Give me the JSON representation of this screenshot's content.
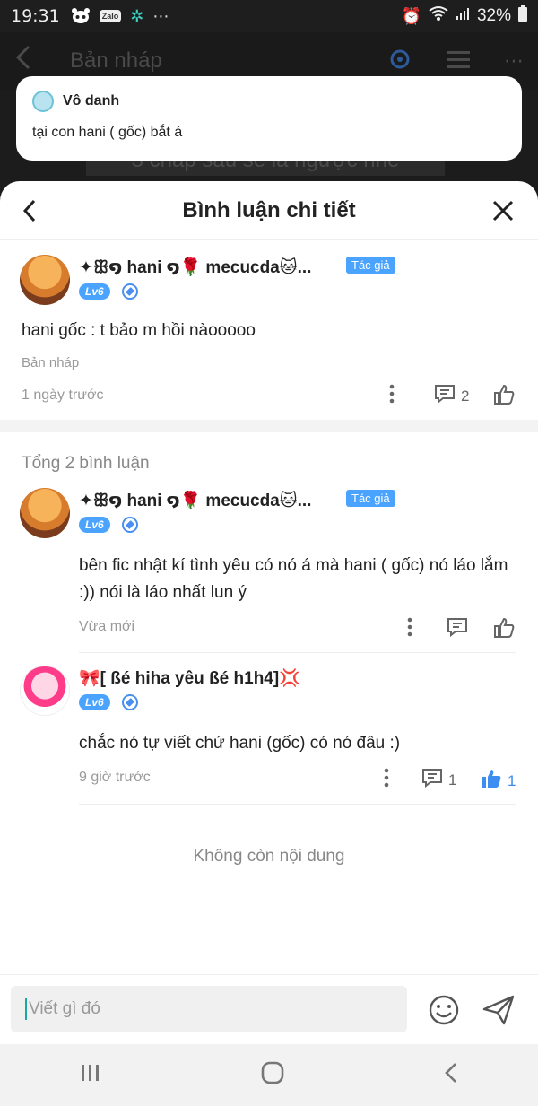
{
  "status": {
    "time": "19:31",
    "battery": "32%",
    "zalo": "Zalo"
  },
  "app": {
    "title": "Bản nháp",
    "bg_text": "3 chap sau sẽ là ngược nhé"
  },
  "notification": {
    "name": "Vô danh",
    "message": "tại con hani ( gốc) bắt á"
  },
  "sheet": {
    "title": "Bình luận chi tiết"
  },
  "main_comment": {
    "username": "✦ꕥ໑ hani ໑🌹 mecucda🐱...",
    "author_badge": "Tác giả",
    "level": "Lv6",
    "text": "hani gốc : t bảo m hồi nàooooo",
    "source": "Bản nháp",
    "time": "1 ngày trước",
    "reply_count": "2"
  },
  "total_label": "Tổng 2 bình luận",
  "replies": [
    {
      "username": "✦ꕥ໑ hani ໑🌹 mecucda🐱...",
      "author_badge": "Tác giả",
      "level": "Lv6",
      "text": "bên fic nhật kí tình yêu có nó á mà hani ( gốc) nó láo lắm :)) nói là láo nhất lun ý",
      "time": "Vừa mới"
    },
    {
      "username": "🎀[ ßé hiha yêu ßé h1h4]💢",
      "level": "Lv6",
      "text": "chắc nó tự viết chứ hani (gốc) có nó đâu :)",
      "time": "9 giờ trước",
      "reply_count": "1",
      "like_count": "1"
    }
  ],
  "end_text": "Không còn nội dung",
  "input": {
    "placeholder": "Viết gì đó"
  },
  "colors": {
    "accent": "#4aa3ff",
    "like_active": "#3d8ef0"
  }
}
